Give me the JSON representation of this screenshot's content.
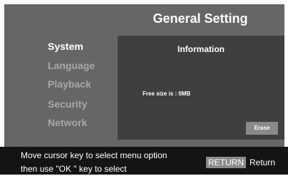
{
  "header": {
    "title": "General Setting"
  },
  "menu": {
    "items": [
      {
        "label": "System",
        "selected": true
      },
      {
        "label": "Language",
        "selected": false
      },
      {
        "label": "Playback",
        "selected": false
      },
      {
        "label": "Security",
        "selected": false
      },
      {
        "label": "Network",
        "selected": false
      }
    ]
  },
  "content": {
    "title": "Information",
    "free_size": "Free size is : 0MB",
    "erase_label": "Erase"
  },
  "footer": {
    "hint_line1": "Move cursor key to select menu option",
    "hint_line2": "then use \"OK \" key to select",
    "return_key": "RETURN",
    "return_label": "Return"
  },
  "colors": {
    "panel": "#666666",
    "content": "#3f3f3f",
    "footer": "#141414",
    "button": "#8a8a8a",
    "menu_inactive": "#a8a8a8",
    "menu_selected": "#ffffff"
  }
}
